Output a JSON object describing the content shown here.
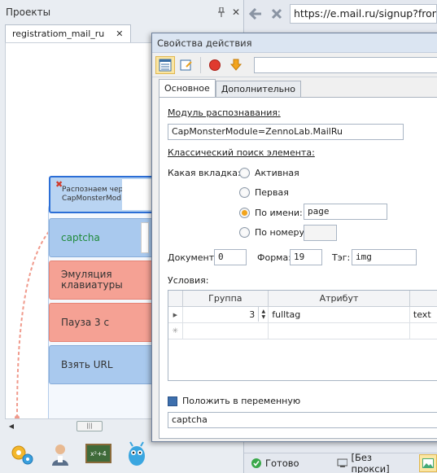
{
  "projects_pane": {
    "title": "Проекты",
    "tab_label": "registratiom_mail_ru",
    "blocks": {
      "recognize": "Распознаем через CapMonsterMod",
      "captcha": "captcha",
      "emulation": "Эмуляция клавиатуры",
      "pause": "Пауза 3 с",
      "get_url": "Взять URL"
    }
  },
  "browser": {
    "url": "https://e.mail.ru/signup?from=",
    "status": {
      "ready": "Готово",
      "proxy": "[Без прокси]"
    }
  },
  "dialog": {
    "title": "Свойства действия",
    "tabs": [
      "Основное",
      "Дополнительно"
    ],
    "module_label": "Модуль распознавания:",
    "module_value": "CapMonsterModule=ZennoLab.MailRu",
    "classic_label": "Классический поиск элемента:",
    "which_tab_label": "Какая вкладка:",
    "radios": {
      "active": "Активная",
      "first": "Первая",
      "by_name": "По имени:",
      "by_number": "По номеру:"
    },
    "by_name_value": "page",
    "by_number_value": "",
    "document_label": "Документ:",
    "document_value": "0",
    "form_label": "Форма:",
    "form_value": "19",
    "tag_label": "Тэг:",
    "tag_value": "img",
    "conditions_label": "Условия:",
    "grid": {
      "headers": [
        "Группа",
        "Атрибут",
        ""
      ],
      "rows": [
        {
          "group": "3",
          "attribute": "fulltag",
          "value": "text"
        }
      ]
    },
    "save_var_label": "Положить в переменную",
    "save_var_value": "captcha"
  },
  "colors": {
    "accent_orange": "#f2a41c",
    "block_blue": "#a9c9ee",
    "block_red": "#f5a194",
    "selection_border": "#2b6ed6"
  }
}
